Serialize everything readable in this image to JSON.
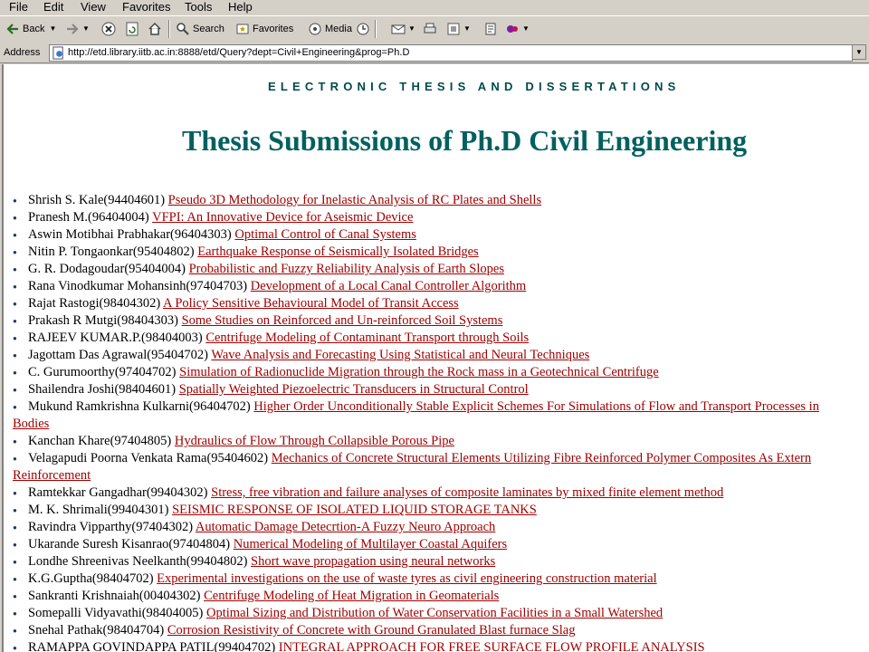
{
  "menu": [
    "File",
    "Edit",
    "View",
    "Favorites",
    "Tools",
    "Help"
  ],
  "toolbar": {
    "back": "Back",
    "search": "Search",
    "favorites": "Favorites",
    "media": "Media"
  },
  "address": {
    "label": "Address",
    "url": "http://etd.library.iitb.ac.in:8888/etd/Query?dept=Civil+Engineering&prog=Ph.D"
  },
  "page": {
    "brand": "ELECTRONIC THESIS AND DISSERTATIONS",
    "title": "Thesis Submissions of Ph.D Civil Engineering"
  },
  "theses": [
    {
      "author": "Shrish S. Kale(94404601)",
      "title": "Pseudo 3D Methodology for Inelastic Analysis of RC Plates and Shells"
    },
    {
      "author": "Pranesh M.(96404004)",
      "title": "VFPI: An Innovative Device for Aseismic Device"
    },
    {
      "author": "Aswin Motibhai Prabhakar(96404303)",
      "title": "Optimal Control of Canal Systems"
    },
    {
      "author": "Nitin P. Tongaonkar(95404802)",
      "title": "Earthquake Response of Seismically Isolated Bridges"
    },
    {
      "author": "G. R. Dodagoudar(95404004)",
      "title": "Probabilistic and Fuzzy Reliability Analysis of Earth Slopes"
    },
    {
      "author": "Rana Vinodkumar Mohansinh(97404703)",
      "title": "Development of a Local Canal Controller Algorithm"
    },
    {
      "author": "Rajat Rastogi(98404302)",
      "title": "A Policy Sensitive Behavioural Model of Transit Access"
    },
    {
      "author": "Prakash R Mutgi(98404303)",
      "title": "Some Studies on Reinforced and Un-reinforced Soil Systems"
    },
    {
      "author": "RAJEEV KUMAR.P.(98404003)",
      "title": "Centrifuge Modeling of Contaminant Transport through Soils"
    },
    {
      "author": "Jagottam Das Agrawal(95404702)",
      "title": "Wave Analysis and Forecasting Using Statistical and Neural Techniques"
    },
    {
      "author": "C. Gurumoorthy(97404702)",
      "title": "Simulation of Radionuclide Migration through the Rock mass in a Geotechnical Centrifuge"
    },
    {
      "author": "Shailendra Joshi(98404601)",
      "title": "Spatially Weighted Piezoelectric Transducers in Structural Control"
    },
    {
      "author": "Mukund Ramkrishna Kulkarni(96404702)",
      "title": "Higher Order Unconditionally Stable Explicit Schemes For Simulations of Flow and Transport Processes in",
      "title_cont": "Bodies"
    },
    {
      "author": "Kanchan Khare(97404805)",
      "title": "Hydraulics of Flow Through Collapsible Porous Pipe"
    },
    {
      "author": "Velagapudi Poorna Venkata Rama(95404602)",
      "title": "Mechanics of Concrete Structural Elements Utilizing Fibre Reinforced Polymer Composites As Extern",
      "title_cont": "Reinforcement"
    },
    {
      "author": "Ramtekkar Gangadhar(99404302)",
      "title": "Stress, free vibration and failure analyses of composite laminates by mixed finite element method"
    },
    {
      "author": "M. K. Shrimali(99404301)",
      "title": "SEISMIC RESPONSE OF ISOLATED LIQUID STORAGE TANKS"
    },
    {
      "author": "Ravindra Vipparthy(97404302)",
      "title": "Automatic Damage Detecrtion-A Fuzzy Neuro Approach"
    },
    {
      "author": "Ukarande Suresh Kisanrao(97404804)",
      "title": "Numerical Modeling of Multilayer Coastal Aquifers"
    },
    {
      "author": "Londhe Shreenivas Neelkanth(99404802)",
      "title": "Short wave propagation using neural networks"
    },
    {
      "author": "K.G.Guptha(98404702)",
      "title": "Experimental investigations on the use of waste tyres as civil engineering construction material"
    },
    {
      "author": "Sankranti Krishnaiah(00404302)",
      "title": "Centrifuge Modeling of Heat Migration in Geomaterials"
    },
    {
      "author": "Somepalli Vidyavathi(98404005)",
      "title": "Optimal Sizing and Distribution of Water Conservation Facilities in a Small Watershed"
    },
    {
      "author": "Snehal Pathak(98404704)",
      "title": "Corrosion Resistivity of Concrete with Ground Granulated Blast furnace Slag"
    },
    {
      "author": "RAMAPPA GOVINDAPPA PATIL(99404702)",
      "title": "INTEGRAL APPROACH FOR FREE SURFACE FLOW PROFILE ANALYSIS"
    }
  ]
}
